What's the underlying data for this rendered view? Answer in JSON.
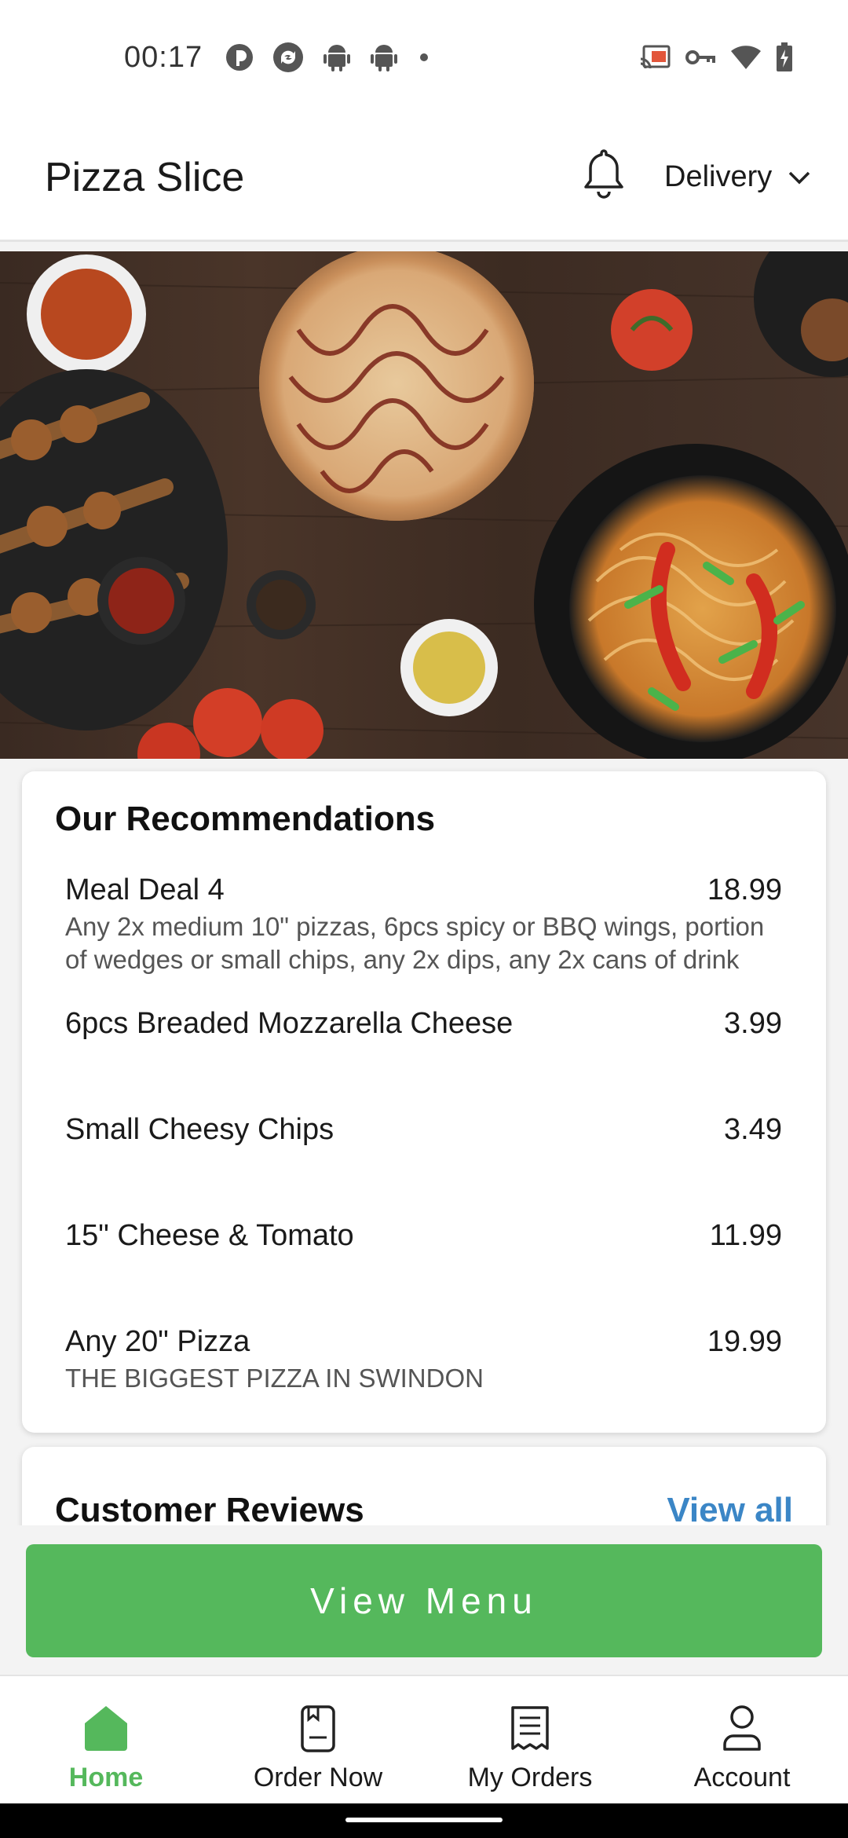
{
  "status_bar": {
    "time": "00:17",
    "left_icons": [
      "pocket-casts-icon",
      "sync-app-icon",
      "android-icon",
      "android-icon",
      "dot-icon"
    ],
    "right_icons": [
      "cast-icon",
      "vpn-key-icon",
      "wifi-icon",
      "battery-icon"
    ]
  },
  "header": {
    "title": "Pizza Slice",
    "bell_icon": "bell-icon",
    "delivery_label": "Delivery",
    "dropdown_icon": "chevron-down-icon"
  },
  "hero": {
    "icon": "food-banner-image"
  },
  "recommendations": {
    "title": "Our Recommendations",
    "items": [
      {
        "name": "Meal Deal 4",
        "price": "18.99",
        "description": "Any 2x medium 10\" pizzas, 6pcs spicy or BBQ wings, portion of wedges or small chips, any 2x dips, any 2x cans of drink"
      },
      {
        "name": "6pcs Breaded Mozzarella Cheese",
        "price": "3.99",
        "description": ""
      },
      {
        "name": "Small Cheesy Chips",
        "price": "3.49",
        "description": ""
      },
      {
        "name": "15\" Cheese & Tomato",
        "price": "11.99",
        "description": ""
      },
      {
        "name": "Any 20\" Pizza",
        "price": "19.99",
        "description": "THE BIGGEST PIZZA IN SWINDON"
      }
    ]
  },
  "reviews": {
    "title": "Customer Reviews",
    "view_all": "View all"
  },
  "cta": {
    "label": "View Menu"
  },
  "nav": {
    "items": [
      {
        "label": "Home",
        "icon": "home-icon",
        "active": true
      },
      {
        "label": "Order Now",
        "icon": "order-icon",
        "active": false
      },
      {
        "label": "My Orders",
        "icon": "receipt-icon",
        "active": false
      },
      {
        "label": "Account",
        "icon": "person-icon",
        "active": false
      }
    ]
  },
  "colors": {
    "accent_green": "#55b85c",
    "link_blue": "#3b86c6"
  }
}
